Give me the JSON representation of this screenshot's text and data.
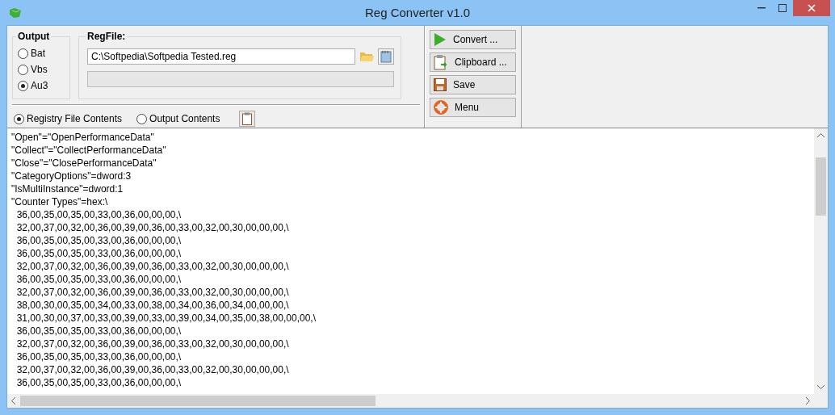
{
  "window": {
    "title": "Reg Converter v1.0"
  },
  "output": {
    "label": "Output",
    "options": [
      {
        "label": "Bat",
        "selected": false
      },
      {
        "label": "Vbs",
        "selected": false
      },
      {
        "label": "Au3",
        "selected": true
      }
    ]
  },
  "regfile": {
    "label": "RegFile:",
    "path": "C:\\Softpedia\\Softpedia Tested.reg",
    "progress": {
      "level": 0
    }
  },
  "view": [
    {
      "label": "Registry File Contents",
      "selected": true
    },
    {
      "label": "Output Contents",
      "selected": false
    }
  ],
  "buttons": [
    {
      "kind": "convert",
      "label": "Convert ..."
    },
    {
      "kind": "clipboard",
      "label": "Clipboard ..."
    },
    {
      "kind": "save",
      "label": "Save"
    },
    {
      "kind": "menu",
      "label": "Menu"
    }
  ],
  "content": [
    "\"Open\"=\"OpenPerformanceData\"",
    "\"Collect\"=\"CollectPerformanceData\"",
    "\"Close\"=\"ClosePerformanceData\"",
    "\"CategoryOptions\"=dword:3",
    "\"IsMultiInstance\"=dword:1",
    "\"Counter Types\"=hex:\\",
    "  36,00,35,00,35,00,33,00,36,00,00,00,\\",
    "  32,00,37,00,32,00,36,00,39,00,36,00,33,00,32,00,30,00,00,00,\\",
    "  36,00,35,00,35,00,33,00,36,00,00,00,\\",
    "  36,00,35,00,35,00,33,00,36,00,00,00,\\",
    "  32,00,37,00,32,00,36,00,39,00,36,00,33,00,32,00,30,00,00,00,\\",
    "  36,00,35,00,35,00,33,00,36,00,00,00,\\",
    "  32,00,37,00,32,00,36,00,39,00,36,00,33,00,32,00,30,00,00,00,\\",
    "  38,00,30,00,35,00,34,00,33,00,38,00,34,00,36,00,34,00,00,00,\\",
    "  31,00,30,00,37,00,33,00,39,00,33,00,39,00,34,00,35,00,38,00,00,00,\\",
    "  36,00,35,00,35,00,33,00,36,00,00,00,\\",
    "  32,00,37,00,32,00,36,00,39,00,36,00,33,00,32,00,30,00,00,00,\\",
    "  36,00,35,00,35,00,33,00,36,00,00,00,\\",
    "  32,00,37,00,32,00,36,00,39,00,36,00,33,00,32,00,30,00,00,00,\\",
    "  36,00,35,00,35,00,33,00,36,00,00,00,\\"
  ]
}
